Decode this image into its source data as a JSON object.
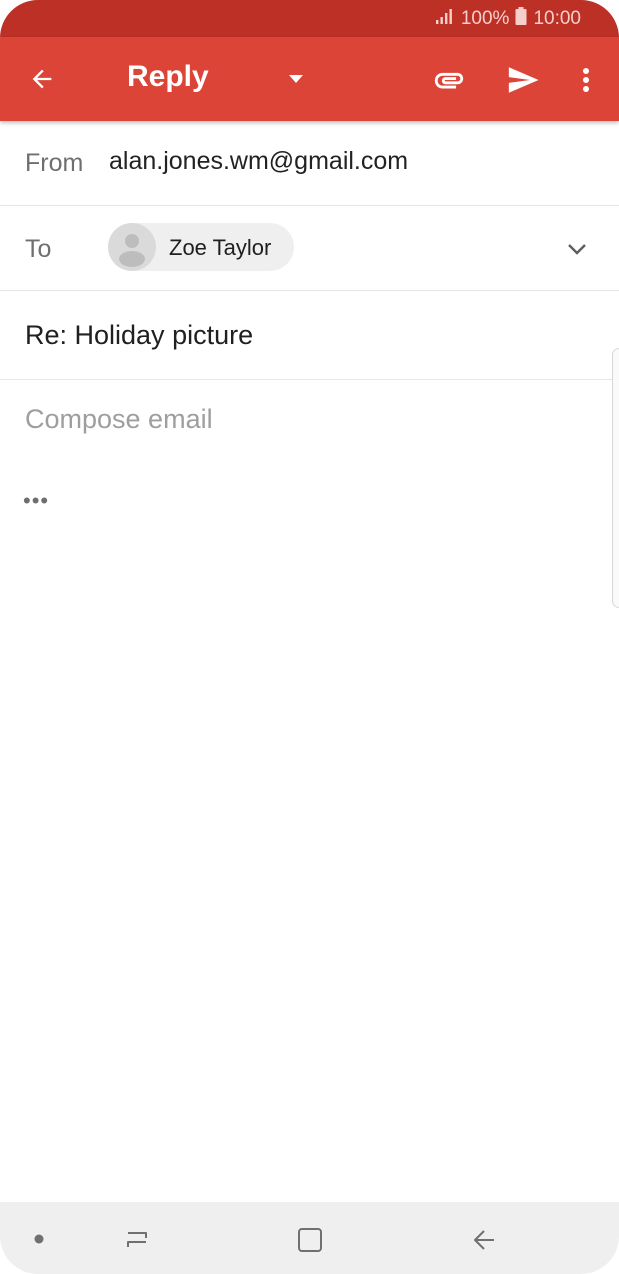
{
  "status_bar": {
    "battery": "100%",
    "time": "10:00"
  },
  "app_bar": {
    "title": "Reply"
  },
  "from": {
    "label": "From",
    "value": "alan.jones.wm@gmail.com"
  },
  "to": {
    "label": "To",
    "recipient": "Zoe Taylor"
  },
  "subject": "Re: Holiday picture",
  "compose": {
    "placeholder": "Compose email"
  },
  "quoted_indicator": "•••",
  "colors": {
    "status_bar": "#bd3026",
    "app_bar": "#db4437"
  }
}
